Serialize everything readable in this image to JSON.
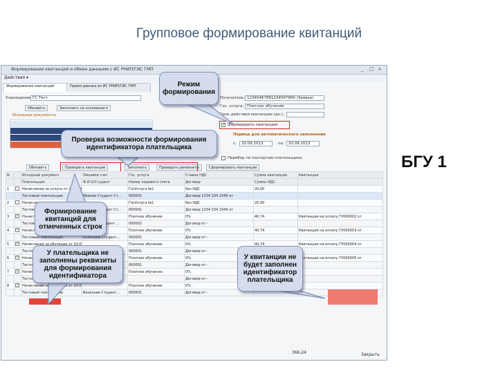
{
  "slide_title": "Групповое формирование квитанций",
  "side_label": "БГУ 1",
  "window": {
    "title": "Формирование квитанций и обмен данными с ИС РНИП/ГИС ГМП",
    "controls": [
      "_",
      "□",
      "×"
    ],
    "menu": "Действия ▾"
  },
  "tabs": [
    "Формирование квитанций",
    "Прием данных из ИС РНИП/ГИС ГМП"
  ],
  "filters": {
    "org_label": "Учреждение:",
    "org_value": "ГС Тест",
    "refresh": "Обновить",
    "select_by": "Заполнить на основании ▾",
    "table_caption": "Исходные документы"
  },
  "right_panel": {
    "payee_label": "Получатель:",
    "payee_value": "12345467891234567890 (Заявка)",
    "service_label": "Гос. услуга:",
    "service_value": "Платное обучение",
    "date_label": "Срок действия квитанции (дн.):",
    "date_value": "",
    "mode_check": "Формировать квитанции",
    "period_title": "Период для автоматического заполнения",
    "period_from": "20.09.2013",
    "period_to": "20.09.2013",
    "period_from_label": "с:",
    "period_to_label": "по:",
    "personal_check": "Перебор по паспортам плательщика"
  },
  "toolbar": {
    "refresh": "Обновить",
    "check": "Проверить квитанции",
    "fill": "Заполнить",
    "verify": "Проверить реквизиты",
    "form": "Сформировать квитанции"
  },
  "table": {
    "headers_row1": [
      "N",
      "",
      "Исходный документ",
      "Лицевой счет",
      "Гос. услуга",
      "Ставка НДС",
      "Сумма квитанции",
      "Квитанция"
    ],
    "headers_row2": [
      "",
      "",
      "Плательщик",
      "Ф.И.О/Студент",
      "Номер лицевого счета",
      "Договор",
      "Сумма НДС",
      ""
    ],
    "rows": [
      [
        "1",
        "",
        "Начисление за услуги от 20.09.2013 12:42:03",
        "",
        "ГосУслуга №1",
        "без НДС",
        "20,00",
        ""
      ],
      [
        "",
        "",
        "Тестовый плательщик",
        "Иванов Студент Ст...",
        "000001",
        "Договор 1234 234 2345 от",
        "",
        ""
      ],
      [
        "2",
        "",
        "Начисление за услуги от 20.09.2013 12:42:03",
        "",
        "ГосУслуга №1",
        "без НДС",
        "20,00",
        ""
      ],
      [
        "",
        "",
        "Тестовый плательщик",
        "Петров Студент Ст...",
        "000001",
        "Договор 1234 234 2345 от",
        "",
        ""
      ],
      [
        "3",
        "",
        "Начисление за обучение от 20.09.2013 16:34:39",
        "",
        "Платное обучение",
        "0%",
        "40,74",
        "Квитанция на оплату ГУ000002 от"
      ],
      [
        "",
        "",
        "Тестовый плательщик",
        "Сидоров Студент ...",
        "000002",
        "Договор от -",
        "",
        ""
      ],
      [
        "4",
        "",
        "Начисление за обучение от 20.09.2013 16:34:39",
        "",
        "Платное обучение",
        "0%",
        "40,74",
        "Квитанция на оплату ГУ000003 от"
      ],
      [
        "",
        "",
        "Тестовый плательщик",
        "Кузнецов Студент...",
        "000001",
        "Договор от -",
        "",
        ""
      ],
      [
        "5",
        "",
        "Начисление за обучение от 20.09.2013 16:34:39",
        "",
        "Платное обучение",
        "0%",
        "40,74",
        "Квитанция на оплату ГУ000004 от"
      ],
      [
        "",
        "",
        "Тестовый плательщик",
        "Смирнов Студент ...",
        "000001",
        "Договор от -",
        "",
        ""
      ],
      [
        "6",
        "",
        "Начисление за обучение от 20.09.2013 16:34:39",
        "",
        "Платное обучение",
        "0%",
        "40,74",
        "Квитанция на оплату ГУ000005 от"
      ],
      [
        "",
        "",
        "Тестовый плательщик",
        "Попов Студент Ст...",
        "000001",
        "Договор от -",
        "",
        ""
      ],
      [
        "7",
        "",
        "Начисление за обучение от 20.09.2013 16:34:39",
        "",
        "Платное обучение",
        "0%",
        "40,74",
        ""
      ],
      [
        "",
        "",
        "Тестовый плательщик",
        "",
        "",
        "Договор от -",
        "",
        ""
      ],
      [
        "8",
        "",
        "Начисление за обучение от 20.09.2013 16:34:39",
        "",
        "Платное обучение",
        "0%",
        "40,74",
        ""
      ],
      [
        "",
        "",
        "Тестовый плательщик",
        "Васильев Студент...",
        "000001",
        "Договор от -",
        "",
        ""
      ]
    ]
  },
  "total": "366,24",
  "close": "Закрыть",
  "callouts": {
    "mode": "Режим формирования",
    "check_id": "Проверка возможности формирования идентификатора плательщика",
    "form_marked": "Формирование квитанций для отмеченных строк",
    "no_payer": "У плательщика не заполнены реквизиты для формирования идентификатора",
    "no_id": "У квитанции не будет заполнен идентификатор плательщика"
  }
}
